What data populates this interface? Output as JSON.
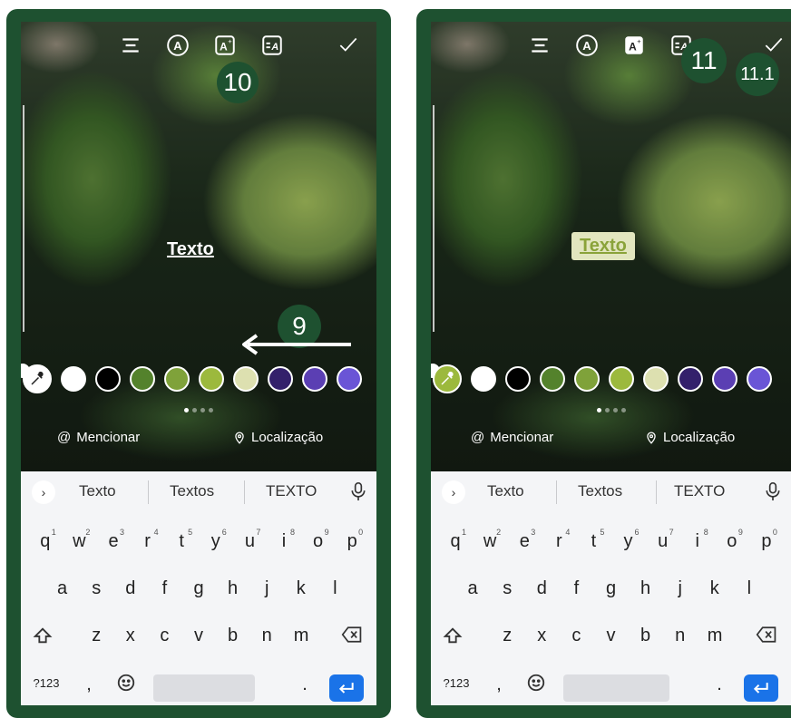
{
  "colors": {
    "frame": "#1e5130",
    "badge": "#1e5130",
    "keyboard_bg": "#f4f5f7",
    "enter_key": "#1a73e8",
    "text_box_bg": "#e2e6bf",
    "text_box_fg": "#8aa33a"
  },
  "icons": [
    "align-center-icon",
    "font-style-icon",
    "text-effects-icon",
    "text-animation-icon",
    "checkmark-icon",
    "eyedropper-icon",
    "at-sign-icon",
    "location-pin-icon",
    "microphone-icon",
    "shift-icon",
    "backspace-icon",
    "emoji-icon",
    "enter-icon"
  ],
  "left": {
    "canvas_text": "Texto",
    "badges": {
      "step_a": "10",
      "step_b": "9"
    },
    "palette": [
      "#ffffff",
      "#000000",
      "#54822c",
      "#7fa23a",
      "#9cb93d",
      "#dde0b0",
      "#33206b",
      "#5b3fb3",
      "#6a55d6"
    ],
    "page_dots": 4,
    "mention": "Mencionar",
    "location": "Localização",
    "suggestions": [
      "Texto",
      "Textos",
      "TEXTO"
    ],
    "row1": [
      {
        "k": "q",
        "n": "1"
      },
      {
        "k": "w",
        "n": "2"
      },
      {
        "k": "e",
        "n": "3"
      },
      {
        "k": "r",
        "n": "4"
      },
      {
        "k": "t",
        "n": "5"
      },
      {
        "k": "y",
        "n": "6"
      },
      {
        "k": "u",
        "n": "7"
      },
      {
        "k": "i",
        "n": "8"
      },
      {
        "k": "o",
        "n": "9"
      },
      {
        "k": "p",
        "n": "0"
      }
    ],
    "row2": [
      "a",
      "s",
      "d",
      "f",
      "g",
      "h",
      "j",
      "k",
      "l"
    ],
    "row3": [
      "z",
      "x",
      "c",
      "v",
      "b",
      "n",
      "m"
    ],
    "sym": "?123",
    "comma": ",",
    "period": "."
  },
  "right": {
    "canvas_text": "Texto",
    "badges": {
      "step_a": "11",
      "step_b": "11.1"
    },
    "palette": [
      "#ffffff",
      "#000000",
      "#54822c",
      "#7fa23a",
      "#9cb93d",
      "#dde0b0",
      "#33206b",
      "#5b3fb3",
      "#6a55d6"
    ],
    "page_dots": 4,
    "mention": "Mencionar",
    "location": "Localização",
    "suggestions": [
      "Texto",
      "Textos",
      "TEXTO"
    ],
    "row1": [
      {
        "k": "q",
        "n": "1"
      },
      {
        "k": "w",
        "n": "2"
      },
      {
        "k": "e",
        "n": "3"
      },
      {
        "k": "r",
        "n": "4"
      },
      {
        "k": "t",
        "n": "5"
      },
      {
        "k": "y",
        "n": "6"
      },
      {
        "k": "u",
        "n": "7"
      },
      {
        "k": "i",
        "n": "8"
      },
      {
        "k": "o",
        "n": "9"
      },
      {
        "k": "p",
        "n": "0"
      }
    ],
    "row2": [
      "a",
      "s",
      "d",
      "f",
      "g",
      "h",
      "j",
      "k",
      "l"
    ],
    "row3": [
      "z",
      "x",
      "c",
      "v",
      "b",
      "n",
      "m"
    ],
    "sym": "?123",
    "comma": ",",
    "period": "."
  }
}
